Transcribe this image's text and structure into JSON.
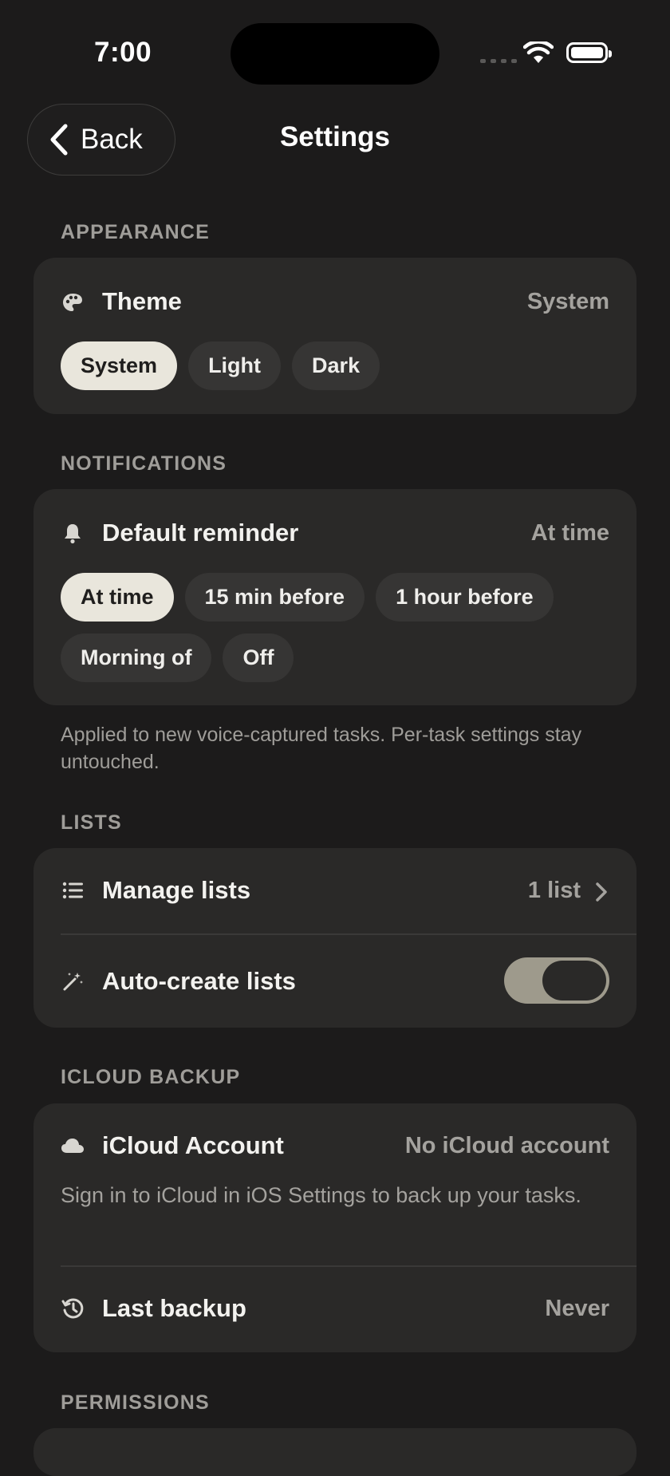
{
  "status_bar": {
    "time": "7:00"
  },
  "nav": {
    "back_label": "Back",
    "title": "Settings"
  },
  "appearance": {
    "header": "APPEARANCE",
    "theme_title": "Theme",
    "theme_value": "System",
    "options": [
      {
        "label": "System",
        "selected": true
      },
      {
        "label": "Light",
        "selected": false
      },
      {
        "label": "Dark",
        "selected": false
      }
    ]
  },
  "notifications": {
    "header": "NOTIFICATIONS",
    "reminder_title": "Default reminder",
    "reminder_value": "At time",
    "options": [
      {
        "label": "At time",
        "selected": true
      },
      {
        "label": "15 min before",
        "selected": false
      },
      {
        "label": "1 hour before",
        "selected": false
      },
      {
        "label": "Morning of",
        "selected": false
      },
      {
        "label": "Off",
        "selected": false
      }
    ],
    "footnote": "Applied to new voice-captured tasks. Per-task settings stay untouched."
  },
  "lists": {
    "header": "LISTS",
    "manage_title": "Manage lists",
    "manage_value": "1 list",
    "autocreate_title": "Auto-create lists",
    "autocreate_on": true
  },
  "icloud": {
    "header": "ICLOUD BACKUP",
    "account_title": "iCloud Account",
    "account_value": "No iCloud account",
    "account_help": "Sign in to iCloud in iOS Settings to back up your tasks.",
    "last_backup_title": "Last backup",
    "last_backup_value": "Never"
  },
  "permissions": {
    "header": "PERMISSIONS"
  },
  "colors": {
    "background": "#1c1b1b",
    "card": "#2a2928",
    "chip_selected": "#e9e6dc",
    "toggle_on": "#9e9a8c"
  }
}
